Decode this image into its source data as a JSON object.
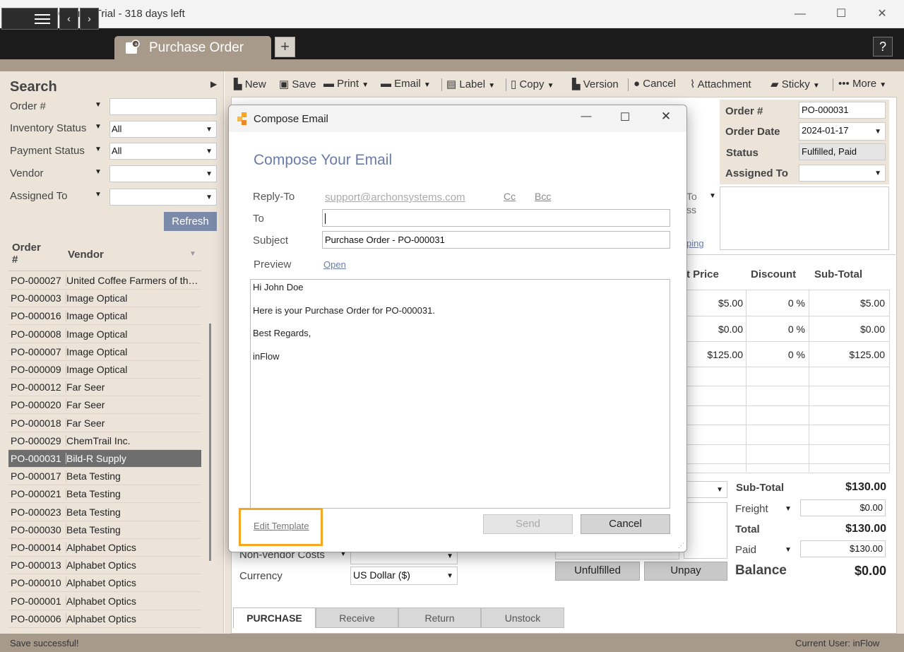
{
  "window": {
    "title": "inFlow Cloud - Trial - 318 days left"
  },
  "tabs": {
    "active": "Purchase Order",
    "add": "+",
    "help": "?"
  },
  "search": {
    "title": "Search",
    "filters": [
      {
        "label": "Order #",
        "value": ""
      },
      {
        "label": "Inventory Status",
        "value": "All"
      },
      {
        "label": "Payment Status",
        "value": "All"
      },
      {
        "label": "Vendor",
        "value": ""
      },
      {
        "label": "Assigned To",
        "value": ""
      }
    ],
    "refresh": "Refresh",
    "col_order": "Order #",
    "col_vendor": "Vendor",
    "rows": [
      {
        "order": "PO-000027",
        "vendor": "United Coffee Farmers of the ..."
      },
      {
        "order": "PO-000003",
        "vendor": "Image Optical"
      },
      {
        "order": "PO-000016",
        "vendor": "Image Optical"
      },
      {
        "order": "PO-000008",
        "vendor": "Image Optical"
      },
      {
        "order": "PO-000007",
        "vendor": "Image Optical"
      },
      {
        "order": "PO-000009",
        "vendor": "Image Optical"
      },
      {
        "order": "PO-000012",
        "vendor": "Far Seer"
      },
      {
        "order": "PO-000020",
        "vendor": "Far Seer"
      },
      {
        "order": "PO-000018",
        "vendor": "Far Seer"
      },
      {
        "order": "PO-000029",
        "vendor": "ChemTrail Inc."
      },
      {
        "order": "PO-000031",
        "vendor": "Bild-R Supply"
      },
      {
        "order": "PO-000017",
        "vendor": "Beta Testing"
      },
      {
        "order": "PO-000021",
        "vendor": "Beta Testing"
      },
      {
        "order": "PO-000023",
        "vendor": "Beta Testing"
      },
      {
        "order": "PO-000030",
        "vendor": "Beta Testing"
      },
      {
        "order": "PO-000014",
        "vendor": "Alphabet Optics"
      },
      {
        "order": "PO-000013",
        "vendor": "Alphabet Optics"
      },
      {
        "order": "PO-000010",
        "vendor": "Alphabet Optics"
      },
      {
        "order": "PO-000001",
        "vendor": "Alphabet Optics"
      },
      {
        "order": "PO-000006",
        "vendor": "Alphabet Optics"
      }
    ]
  },
  "toolbar": {
    "new": "New",
    "save": "Save",
    "print": "Print",
    "email": "Email",
    "label": "Label",
    "copy": "Copy",
    "version": "Version",
    "cancel": "Cancel",
    "attachment": "Attachment",
    "sticky": "Sticky",
    "more": "More"
  },
  "order": {
    "order_no_label": "Order #",
    "order_no": "PO-000031",
    "date_label": "Order Date",
    "date": "2024-01-17",
    "status_label": "Status",
    "status": "Fulfilled, Paid",
    "assigned_label": "Assigned To",
    "assigned": "",
    "ship_to_partial": "To",
    "address_partial": "ss",
    "shipping_link_partial": "ping"
  },
  "items": {
    "col_price": "t Price",
    "col_discount": "Discount",
    "col_subtotal": "Sub-Total",
    "rows": [
      {
        "price": "$5.00",
        "discount": "0 %",
        "subtotal": "$5.00"
      },
      {
        "price": "$0.00",
        "discount": "0 %",
        "subtotal": "$0.00"
      },
      {
        "price": "$125.00",
        "discount": "0 %",
        "subtotal": "$125.00"
      }
    ]
  },
  "totals": {
    "subtotal_label": "Sub-Total",
    "subtotal": "$130.00",
    "freight_label": "Freight",
    "freight": "$0.00",
    "total_label": "Total",
    "total": "$130.00",
    "paid_label": "Paid",
    "paid": "$130.00",
    "balance_label": "Balance",
    "balance": "$0.00"
  },
  "costs": {
    "nonvendor_label": "Non-vendor Costs",
    "currency_label": "Currency",
    "currency": "US Dollar ($)",
    "unfulfilled": "Unfulfilled",
    "unpay": "Unpay"
  },
  "bottom_tabs": [
    "PURCHASE",
    "Receive",
    "Return",
    "Unstock"
  ],
  "status_bar": {
    "message": "Save successful!",
    "user": "Current User:  inFlow"
  },
  "dialog": {
    "title": "Compose Email",
    "heading": "Compose Your Email",
    "reply_to_label": "Reply-To",
    "reply_to": "support@archonsystems.com",
    "cc": "Cc",
    "bcc": "Bcc",
    "to_label": "To",
    "to_value": "",
    "subject_label": "Subject",
    "subject": "Purchase Order - PO-000031",
    "preview_label": "Preview",
    "preview_link": "Open",
    "body": [
      "Hi John Doe",
      "Here is your Purchase Order for PO-000031.",
      "Best Regards,",
      "inFlow"
    ],
    "edit_template": "Edit Template",
    "send": "Send",
    "cancel": "Cancel"
  },
  "colors": {
    "brand_tan": "#a89a8b",
    "panel": "#ece3d9",
    "highlight": "#f5a623",
    "heading_blue": "#6a7ba8"
  }
}
